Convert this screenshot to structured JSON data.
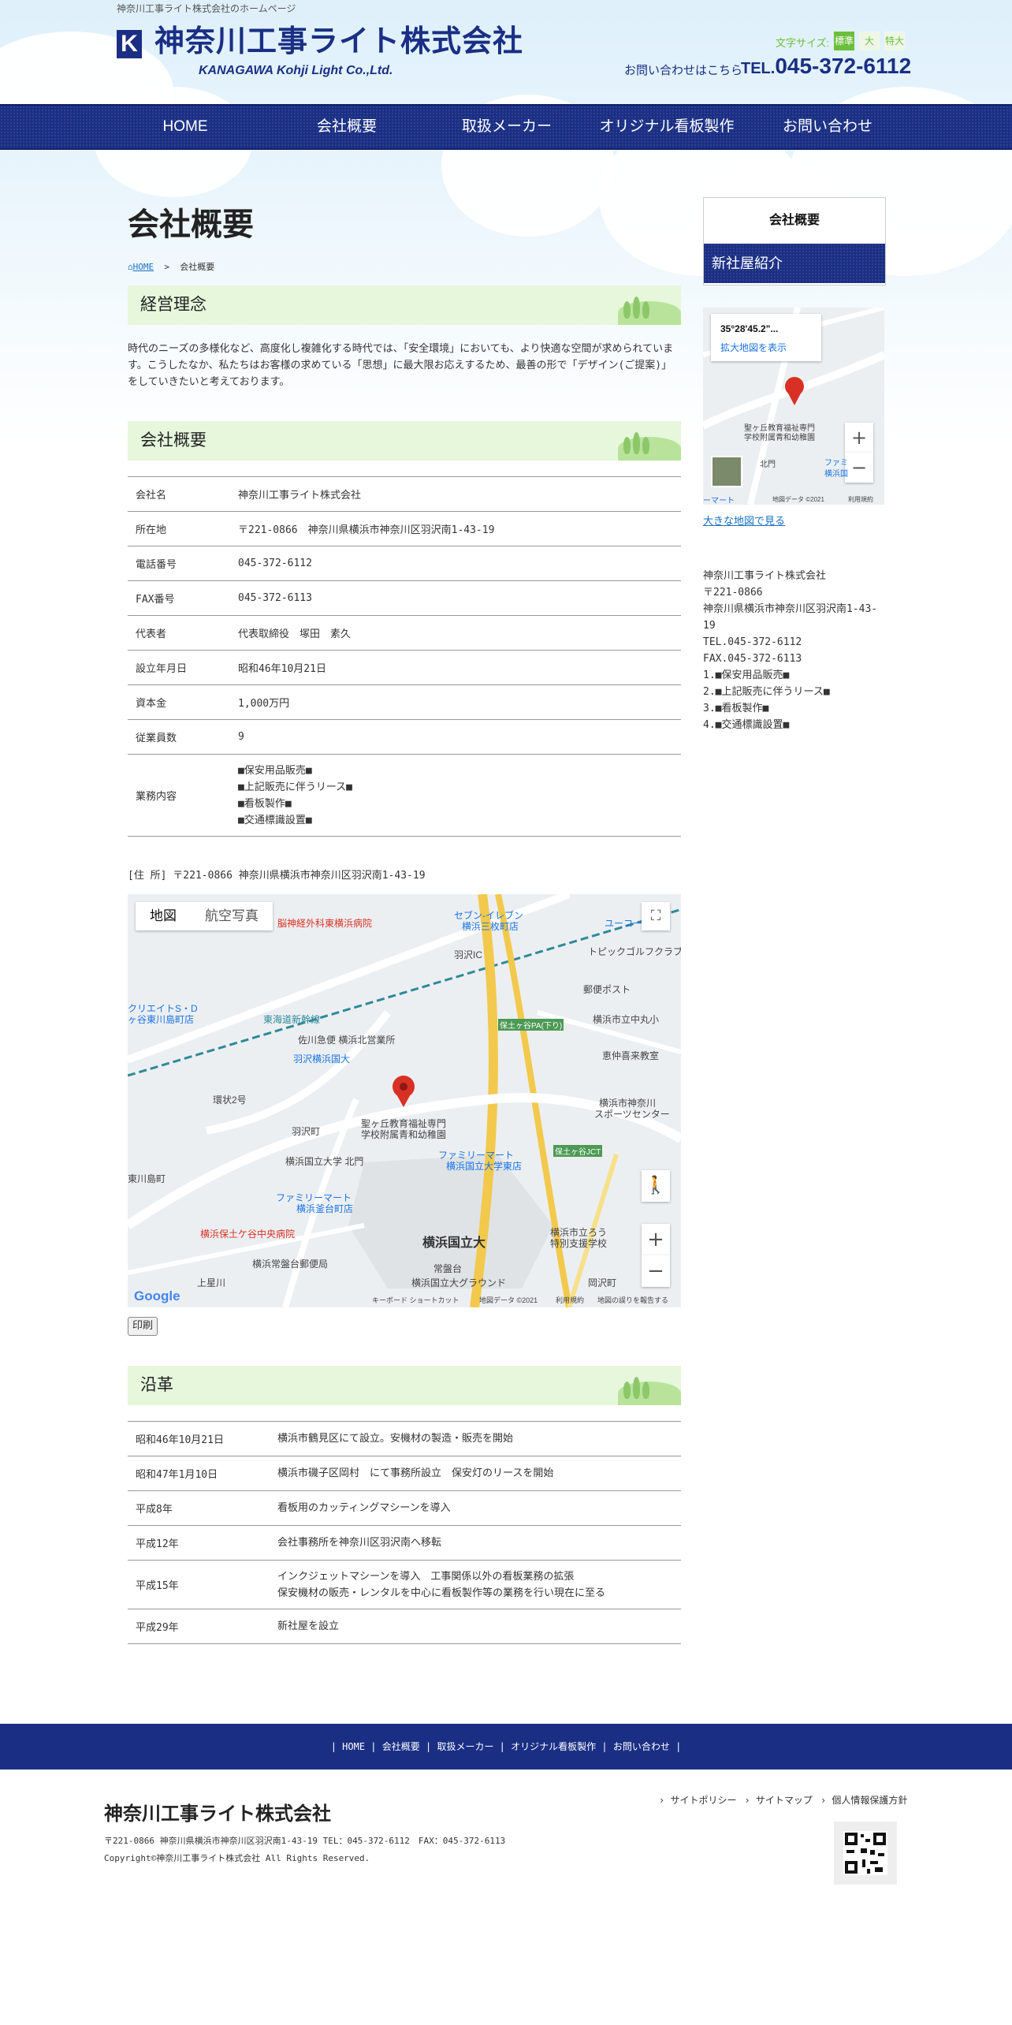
{
  "header": {
    "tagline": "神奈川工事ライト株式会社のホームページ",
    "logo_mark": "K",
    "company": "神奈川工事ライト株式会社",
    "company_en": "KANAGAWA Kohji Light Co.,Ltd.",
    "font_size_label": "文字サイズ:",
    "font_sizes": [
      "標準",
      "大",
      "特大"
    ],
    "contact_label": "お問い合わせはこちら",
    "tel_prefix": "TEL.",
    "tel": "045-372-6112"
  },
  "nav": [
    "HOME",
    "会社概要",
    "取扱メーカー",
    "オリジナル看板製作",
    "お問い合わせ"
  ],
  "main": {
    "title": "会社概要",
    "breadcrumb_home": "HOME",
    "breadcrumb_sep": ">",
    "breadcrumb_current": "会社概要",
    "philosophy_heading": "経営理念",
    "philosophy_text": "時代のニーズの多様化など、高度化し複雑化する時代では、「安全環境」においても、より快適な空間が求められています。こうしたなか、私たちはお客様の求めている「思想」に最大限お応えするため、最善の形で「デザイン(ご提案)」をしていきたいと考えております。",
    "overview_heading": "会社概要",
    "overview": [
      {
        "label": "会社名",
        "value": "神奈川工事ライト株式会社"
      },
      {
        "label": "所在地",
        "value": "〒221-0866　神奈川県横浜市神奈川区羽沢南1-43-19"
      },
      {
        "label": "電話番号",
        "value": "045-372-6112"
      },
      {
        "label": "FAX番号",
        "value": "045-372-6113"
      },
      {
        "label": "代表者",
        "value": "代表取締役　塚田　素久"
      },
      {
        "label": "設立年月日",
        "value": "昭和46年10月21日"
      },
      {
        "label": "資本金",
        "value": "1,000万円"
      },
      {
        "label": "従業員数",
        "value": "9"
      }
    ],
    "business_label": "業務内容",
    "business_items": [
      "■保安用品販売■",
      "■上記販売に伴うリース■",
      "■看板製作■",
      "■交通標識設置■"
    ],
    "address_line": "[住 所] 〒221-0866 神奈川県横浜市神奈川区羽沢南1-43-19",
    "print_label": "印刷",
    "history_heading": "沿革",
    "history": [
      {
        "date": "昭和46年10月21日",
        "text": [
          "横浜市鶴見区にて設立。安機材の製造・販売を開始"
        ]
      },
      {
        "date": "昭和47年1月10日",
        "text": [
          "横浜市磯子区岡村　にて事務所設立　保安灯のリースを開始"
        ]
      },
      {
        "date": "平成8年",
        "text": [
          "看板用のカッティングマシーンを導入"
        ]
      },
      {
        "date": "平成12年",
        "text": [
          "会社事務所を神奈川区羽沢南へ移転"
        ]
      },
      {
        "date": "平成15年",
        "text": [
          "インクジェットマシーンを導入　工事関係以外の看板業務の拡張",
          "保安機材の販売・レンタルを中心に看板製作等の業務を行い現在に至る"
        ]
      },
      {
        "date": "平成29年",
        "text": [
          "新社屋を設立"
        ]
      }
    ]
  },
  "map_large": {
    "tab_map": "地図",
    "tab_satellite": "航空写真",
    "google": "Google",
    "footer": [
      "キーボード ショートカット",
      "地図データ ©2021",
      "利用規約",
      "地図の誤りを報告する"
    ],
    "labels": [
      "脳神経外科東横浜病院",
      "セブン-イレブン",
      "横浜三枚町店",
      "羽沢IC",
      "ユーコー",
      "トピックゴルフクラブ",
      "郵便ポスト",
      "クリエイトS・D",
      "ヶ谷東川島町店",
      "東海道新幹線",
      "保土ヶ谷PA(下り)",
      "横浜市立中丸小",
      "佐川急便 横浜北営業所",
      "恵仲喜来教室",
      "羽沢横浜国大",
      "聖ヶ丘教育福祉専門",
      "学校附属青和幼稚園",
      "横浜市神奈川",
      "スポーツセンター",
      "環状2号",
      "羽沢町",
      "横浜国立大学 北門",
      "ファミリーマート",
      "横浜国立大学東店",
      "保土ヶ谷JCT",
      "東川島町",
      "ファミリーマート",
      "横浜釜台町店",
      "横浜保土ケ谷中央病院",
      "横浜国立大",
      "横浜市立ろう",
      "特別支援学校",
      "横浜常盤台郵便局",
      "上星川",
      "常盤台",
      "横浜国立大グラウンド",
      "岡沢町"
    ]
  },
  "sidebar": {
    "title": "会社概要",
    "item": "新社屋紹介",
    "map_coord": "35°28'45.2\"...",
    "map_enlarge": "拡大地図を表示",
    "map_labels": [
      "聖ヶ丘教育福祉専門",
      "学校附属青和幼稚園",
      "北門",
      "ファミ",
      "横浜国",
      "ーマート"
    ],
    "map_footer": [
      "地図データ ©2021",
      "利用規約"
    ],
    "big_map_link": "大きな地図で見る",
    "info": [
      "神奈川工事ライト株式会社",
      "〒221-0866",
      "神奈川県横浜市神奈川区羽沢南1-43-19",
      "TEL.045-372-6112",
      "FAX.045-372-6113",
      "1.■保安用品販売■",
      "2.■上記販売に伴うリース■",
      "3.■看板製作■",
      "4.■交通標識設置■"
    ]
  },
  "footer": {
    "nav": [
      "HOME",
      "会社概要",
      "取扱メーカー",
      "オリジナル看板製作",
      "お問い合わせ"
    ],
    "company": "神奈川工事ライト株式会社",
    "address": "〒221-0866 神奈川県横浜市神奈川区羽沢南1-43-19 TEL：045-372-6112　FAX：045-372-6113",
    "copyright": "Copyright©神奈川工事ライト株式会社 All Rights Reserved.",
    "links": [
      "サイトポリシー",
      "サイトマップ",
      "個人情報保護方針"
    ]
  },
  "colors": {
    "brand": "#1a2f84",
    "accent_green": "#6cbf3c",
    "heading_bg": "#e6f7dc",
    "link": "#1a6fc4"
  }
}
